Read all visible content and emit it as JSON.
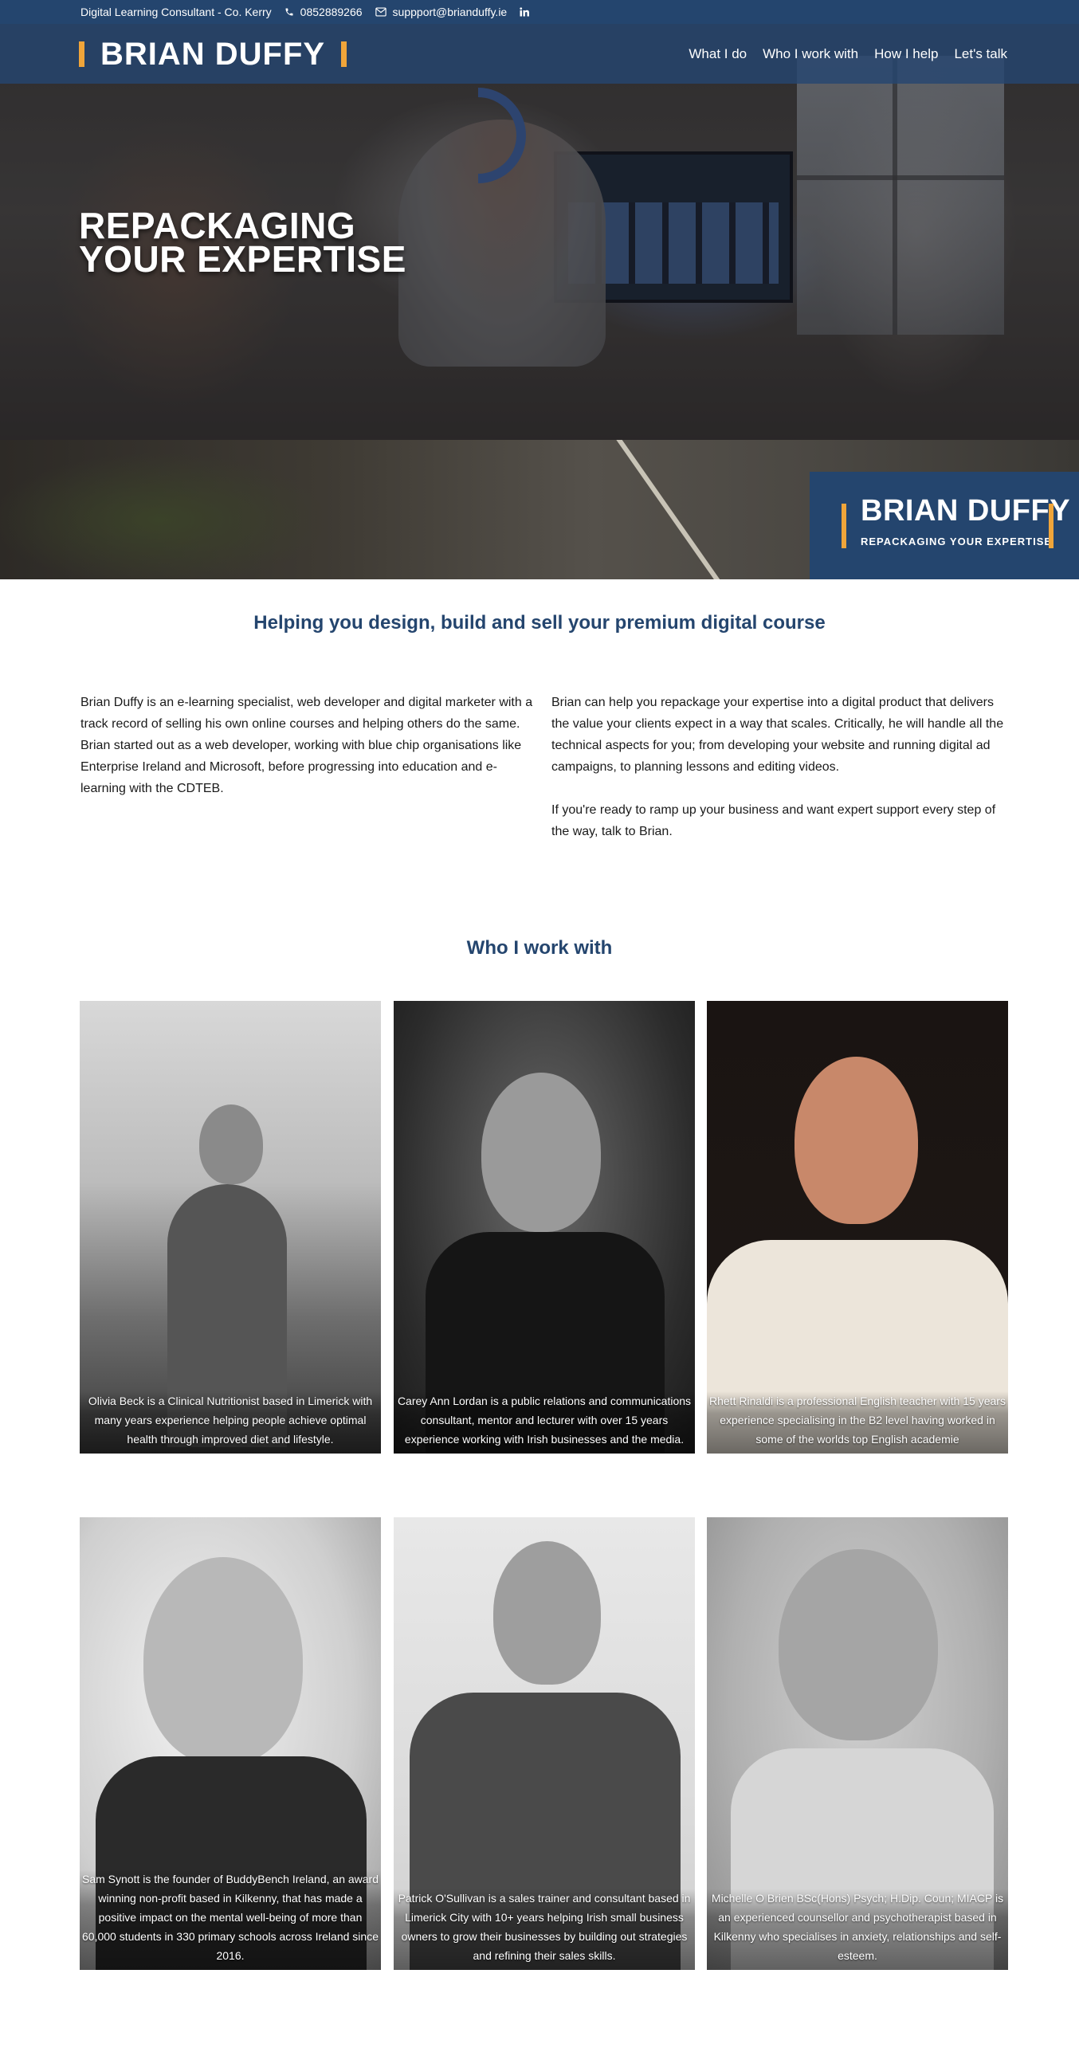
{
  "topbar": {
    "tagline": "Digital Learning Consultant - Co. Kerry",
    "phone": "0852889266",
    "email": "suppport@brianduffy.ie",
    "icons": [
      "phone-icon",
      "envelope-icon",
      "linkedin-icon"
    ]
  },
  "header": {
    "logo": "BRIAN DUFFY",
    "nav": [
      "What I do",
      "Who I work with",
      "How I help",
      "Let's talk"
    ]
  },
  "hero": {
    "title_line1": "REPACKAGING",
    "title_line2": "YOUR EXPERTISE"
  },
  "badge": {
    "name": "BRIAN DUFFY",
    "subtitle": "REPACKAGING YOUR EXPERTISE"
  },
  "intro": {
    "heading": "Helping you design, build and sell your premium digital course",
    "left": "Brian Duffy is an e-learning specialist, web developer and digital marketer with a track record of selling his own online courses and helping others do the same. Brian started out as a web developer, working with blue chip organisations like Enterprise Ireland and Microsoft, before progressing into education and e-learning with the CDTEB.",
    "right_p1": "Brian can help you repackage your expertise into a digital product that delivers the value your clients expect in a way that scales. Critically, he will handle all the technical aspects for you; from developing your website and running digital ad campaigns, to planning lessons and editing videos.",
    "right_p2": "If you're ready to ramp up your business and want expert support every step of the way, talk to Brian."
  },
  "who": {
    "heading": "Who I work with",
    "cards": [
      {
        "caption": "Olivia Beck is a Clinical Nutritionist based in Limerick with many years experience helping people achieve optimal health through improved diet and lifestyle."
      },
      {
        "caption": "Carey Ann Lordan is a public relations and communications consultant, mentor and lecturer with over 15 years experience working with Irish businesses and the media."
      },
      {
        "caption": "Rhett Rinaldi is a professional English teacher with 15 years experience specialising in the B2 level having worked in some of the worlds top English academie"
      },
      {
        "caption": "Sam Synott is the founder of BuddyBench Ireland, an award winning non-profit based in Kilkenny, that has made a positive impact on the mental well-being of more than 60,000 students in 330 primary schools across Ireland since 2016."
      },
      {
        "caption": "Patrick O'Sullivan is a sales trainer and consultant based in Limerick City with 10+ years helping Irish small business owners to grow their businesses by building out strategies and refining their sales skills."
      },
      {
        "caption": "Michelle O Brien BSc(Hons) Psych; H.Dip. Coun; MIACP is an experienced counsellor and psychotherapist based in Kilkenny who specialises in anxiety, relationships and self-esteem."
      }
    ]
  },
  "colors": {
    "brand_navy": "#24456e",
    "accent_orange": "#f0a53a"
  }
}
